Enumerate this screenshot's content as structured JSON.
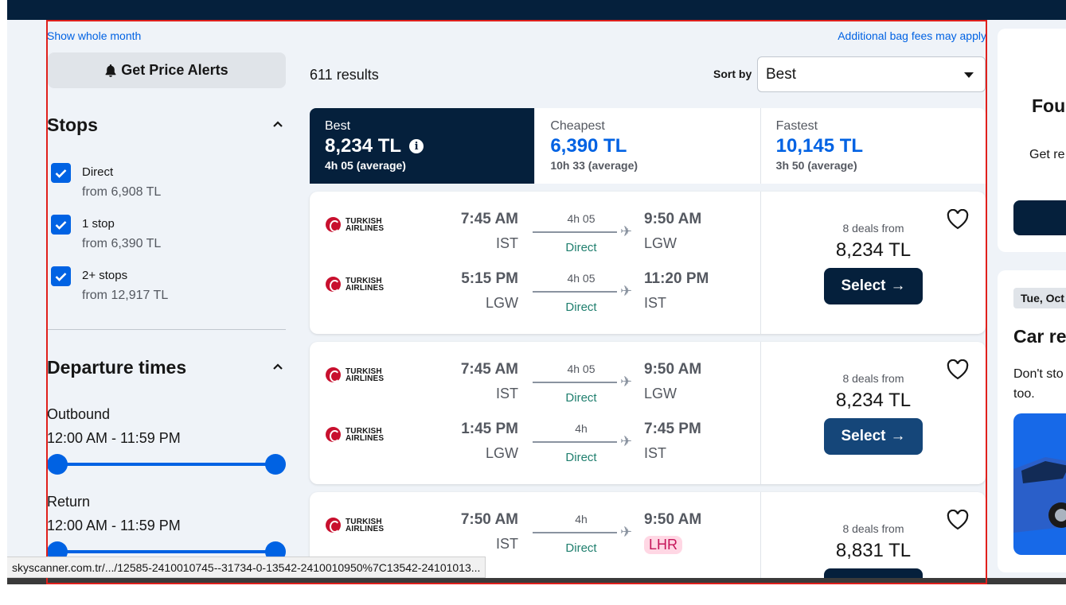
{
  "header": {
    "show_month": "Show whole month",
    "bag_fees": "Additional bag fees may apply"
  },
  "sidebar": {
    "price_alerts": "Get Price Alerts",
    "stops_title": "Stops",
    "stops": [
      {
        "label": "Direct",
        "price": "from 6,908 TL",
        "checked": true
      },
      {
        "label": "1 stop",
        "price": "from 6,390 TL",
        "checked": true
      },
      {
        "label": "2+ stops",
        "price": "from 12,917 TL",
        "checked": true
      }
    ],
    "departure_title": "Departure times",
    "outbound_label": "Outbound",
    "outbound_range": "12:00 AM - 11:59 PM",
    "return_label": "Return",
    "return_range": "12:00 AM - 11:59 PM"
  },
  "results": {
    "count": "611 results",
    "sort_label": "Sort by",
    "sort_value": "Best"
  },
  "tabs": [
    {
      "name": "Best",
      "price": "8,234 TL",
      "sub": "4h 05 (average)",
      "active": true
    },
    {
      "name": "Cheapest",
      "price": "6,390 TL",
      "sub": "10h 33 (average)",
      "active": false
    },
    {
      "name": "Fastest",
      "price": "10,145 TL",
      "sub": "3h 50 (average)",
      "active": false
    }
  ],
  "airline_logo_text": [
    "TURKISH",
    "AIRLINES"
  ],
  "cards": [
    {
      "legs": [
        {
          "dep_time": "7:45 AM",
          "dep_code": "IST",
          "duration": "4h 05",
          "stops": "Direct",
          "arr_time": "9:50 AM",
          "arr_code": "LGW"
        },
        {
          "dep_time": "5:15 PM",
          "dep_code": "LGW",
          "duration": "4h 05",
          "stops": "Direct",
          "arr_time": "11:20 PM",
          "arr_code": "IST"
        }
      ],
      "deals": "8 deals from",
      "price": "8,234 TL",
      "select": "Select"
    },
    {
      "legs": [
        {
          "dep_time": "7:45 AM",
          "dep_code": "IST",
          "duration": "4h 05",
          "stops": "Direct",
          "arr_time": "9:50 AM",
          "arr_code": "LGW"
        },
        {
          "dep_time": "1:45 PM",
          "dep_code": "LGW",
          "duration": "4h",
          "stops": "Direct",
          "arr_time": "7:45 PM",
          "arr_code": "IST"
        }
      ],
      "deals": "8 deals from",
      "price": "8,234 TL",
      "select": "Select"
    },
    {
      "legs": [
        {
          "dep_time": "7:50 AM",
          "dep_code": "IST",
          "duration": "4h",
          "stops": "Direct",
          "arr_time": "9:50 AM",
          "arr_code": "LHR"
        }
      ],
      "deals": "8 deals from",
      "price": "8,831 TL"
    }
  ],
  "right_ads": {
    "ad1_title": "Fou",
    "ad1_sub": "Get re",
    "ad2_date": "Tue, Oct",
    "ad2_title": "Car re",
    "ad2_text_1": "Don't sto",
    "ad2_text_2": "too."
  },
  "status_url": "skyscanner.com.tr/.../12585-2410010745--31734-0-13542-2410010950%7C13542-24101013...",
  "colors": {
    "navy": "#05203c",
    "accent_blue": "#0062e3",
    "direct_green": "#1f7f6e",
    "highlight_pink": "#ffd7e4"
  }
}
